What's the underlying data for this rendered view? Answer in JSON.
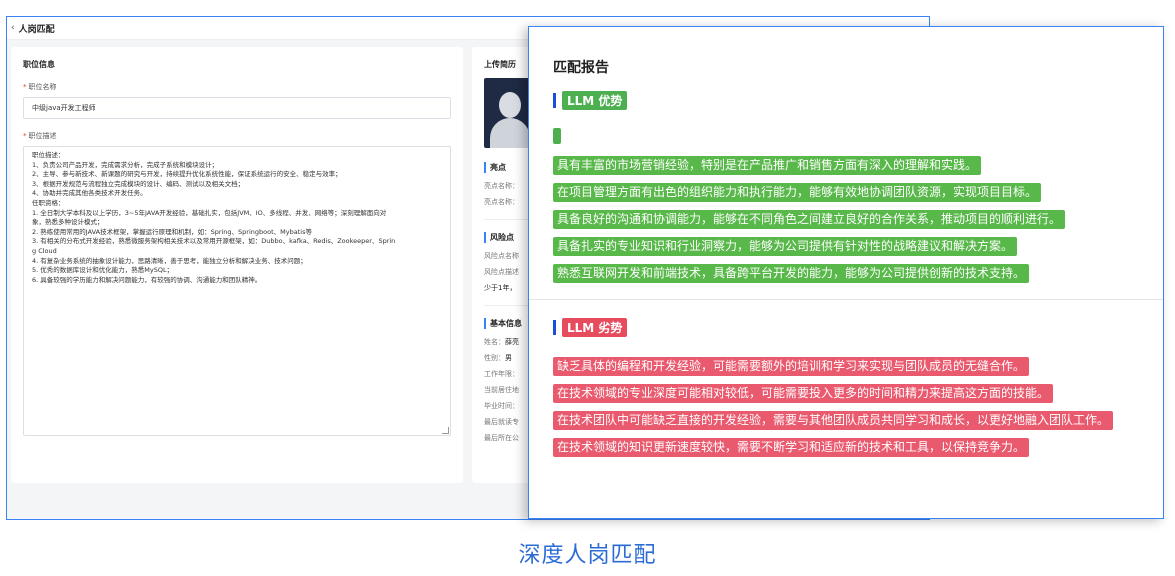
{
  "back_window": {
    "title": "人岗匹配",
    "job_info": {
      "section_title": "职位信息",
      "name_label": "职位名称",
      "name_value": "中级java开发工程师",
      "desc_label": "职位描述",
      "desc_lines": [
        "职位描述：",
        "1、负责公司产品开发，完成需求分析，完成子系统和模块设计；",
        "2、主导、参与新技术、新课题的研究与开发，持续提升优化系统性能，保证系统运行的安全、稳定与效率；",
        "3、根据开发规范与流程独立完成模块的设计、编码、测试以及相关文档；",
        "4、协助并完成其他各类技术开发任务。",
        "任职资格：",
        "1. 全日制大学本科及以上学历，3~5年JAVA开发经验，基础扎实，包括JVM、IO、多线程、并发、网络等；深刻理解面向对",
        "象，熟悉多种设计模式；",
        "2. 熟练使用常用的JAVA技术框架，掌握运行原理和机制，如：Spring、Springboot、Mybatis等",
        "3. 有相关的分布式开发经验，熟悉微服务架构相关技术以及常用开源框架，如：Dubbo、kafka、Redis、Zookeeper、Sprin",
        "g Cloud",
        "4. 有复杂业务系统的抽象设计能力，思路清晰，善于思考，能独立分析和解决业务、技术问题；",
        "5. 优秀的数据库设计和优化能力，熟悉MySQL；",
        "6. 具备较强的学历能力和解决问题能力，有较强的协调、沟通能力和团队精神。"
      ]
    },
    "resume": {
      "section_title": "上传简历",
      "highlights_title": "亮点",
      "highlight_name_label": "亮点名称：",
      "highlight_desc_label": "亮点名称：",
      "risks_title": "风险点",
      "risk_name_label": "风险点名称",
      "risk_desc_label": "风险点描述",
      "risk_text": "少于1年，",
      "basic_title": "基本信息",
      "basic": [
        {
          "label": "姓名：",
          "value": "薛亮"
        },
        {
          "label": "性别：",
          "value": "男"
        },
        {
          "label": "工作年限：",
          "value": ""
        },
        {
          "label": "当前居住地",
          "value": ""
        },
        {
          "label": "毕业时间：",
          "value": ""
        },
        {
          "label": "最后就读专",
          "value": ""
        },
        {
          "label": "最后所在公",
          "value": ""
        }
      ]
    }
  },
  "report": {
    "title": "匹配报告",
    "strengths_tag": "LLM 优势",
    "strengths": [
      "具有丰富的市场营销经验，特别是在产品推广和销售方面有深入的理解和实践。",
      "在项目管理方面有出色的组织能力和执行能力，能够有效地协调团队资源，实现项目目标。",
      "具备良好的沟通和协调能力，能够在不同角色之间建立良好的合作关系，推动项目的顺利进行。",
      "具备扎实的专业知识和行业洞察力，能够为公司提供有针对性的战略建议和解决方案。",
      "熟悉互联网开发和前端技术，具备跨平台开发的能力，能够为公司提供创新的技术支持。"
    ],
    "weaknesses_tag": "LLM 劣势",
    "weaknesses": [
      "缺乏具体的编程和开发经验，可能需要额外的培训和学习来实现与团队成员的无缝合作。",
      "在技术领域的专业深度可能相对较低，可能需要投入更多的时间和精力来提高这方面的技能。",
      "在技术团队中可能缺乏直接的开发经验，需要与其他团队成员共同学习和成长，以更好地融入团队工作。",
      "在技术领域的知识更新速度较快，需要不断学习和适应新的技术和工具，以保持竞争力。"
    ]
  },
  "caption": "深度人岗匹配",
  "colors": {
    "accent": "#3b82f6",
    "strength": "#58b84a",
    "weakness": "#ea5a6e",
    "caption": "#2b6cd4"
  }
}
